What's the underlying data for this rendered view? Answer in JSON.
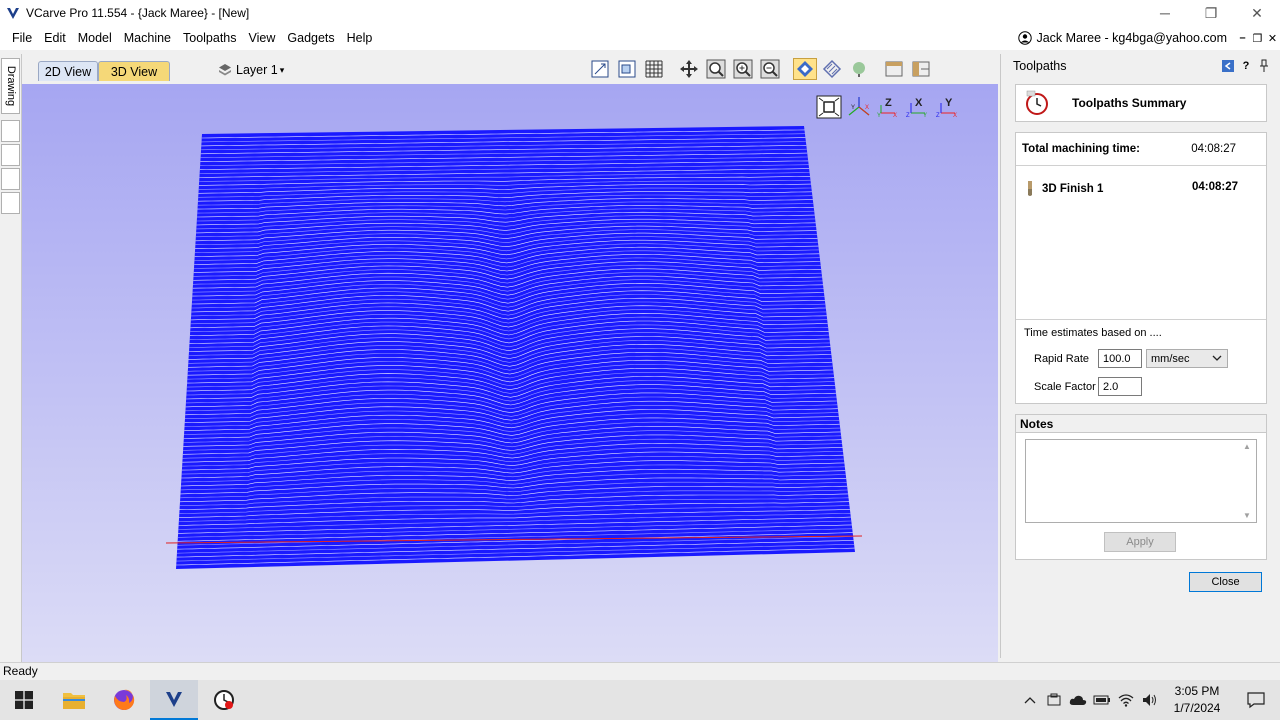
{
  "window": {
    "title": "VCarve Pro 11.554 - {Jack Maree} - [New]",
    "controls": {
      "minimize": "─",
      "maximize": "❐",
      "close": "✕"
    }
  },
  "menu": {
    "items": [
      "File",
      "Edit",
      "Model",
      "Machine",
      "Toolpaths",
      "View",
      "Gadgets",
      "Help"
    ],
    "user": "Jack Maree - kg4bga@yahoo.com",
    "mini_controls": [
      "–",
      "❐",
      "✕"
    ]
  },
  "left_strip": {
    "drawing_tab": "Drawing"
  },
  "view_toolbar": {
    "tabs": [
      "2D View",
      "3D View"
    ],
    "active_tab": "3D View",
    "layer": "Layer 1"
  },
  "toolpaths_panel": {
    "title": "Toolpaths",
    "summary_title": "Toolpaths Summary",
    "total_label": "Total machining time:",
    "total_value": "04:08:27",
    "toolpaths": [
      {
        "name": "3D Finish 1",
        "time": "04:08:27"
      }
    ],
    "estimates_label": "Time estimates based on ....",
    "rapid_rate_label": "Rapid Rate",
    "rapid_rate_value": "100.0",
    "rapid_rate_unit": "mm/sec",
    "scale_factor_label": "Scale Factor",
    "scale_factor_value": "2.0",
    "notes_title": "Notes",
    "notes_value": "",
    "apply_label": "Apply",
    "close_label": "Close"
  },
  "status": {
    "text": "Ready"
  },
  "taskbar": {
    "time": "3:05 PM",
    "date": "1/7/2024"
  },
  "colors": {
    "toolpath_blue": "#1a1aff",
    "viewport_top": "#a6a6f2",
    "active_tab": "#f5d878",
    "accent": "#0078d7"
  }
}
